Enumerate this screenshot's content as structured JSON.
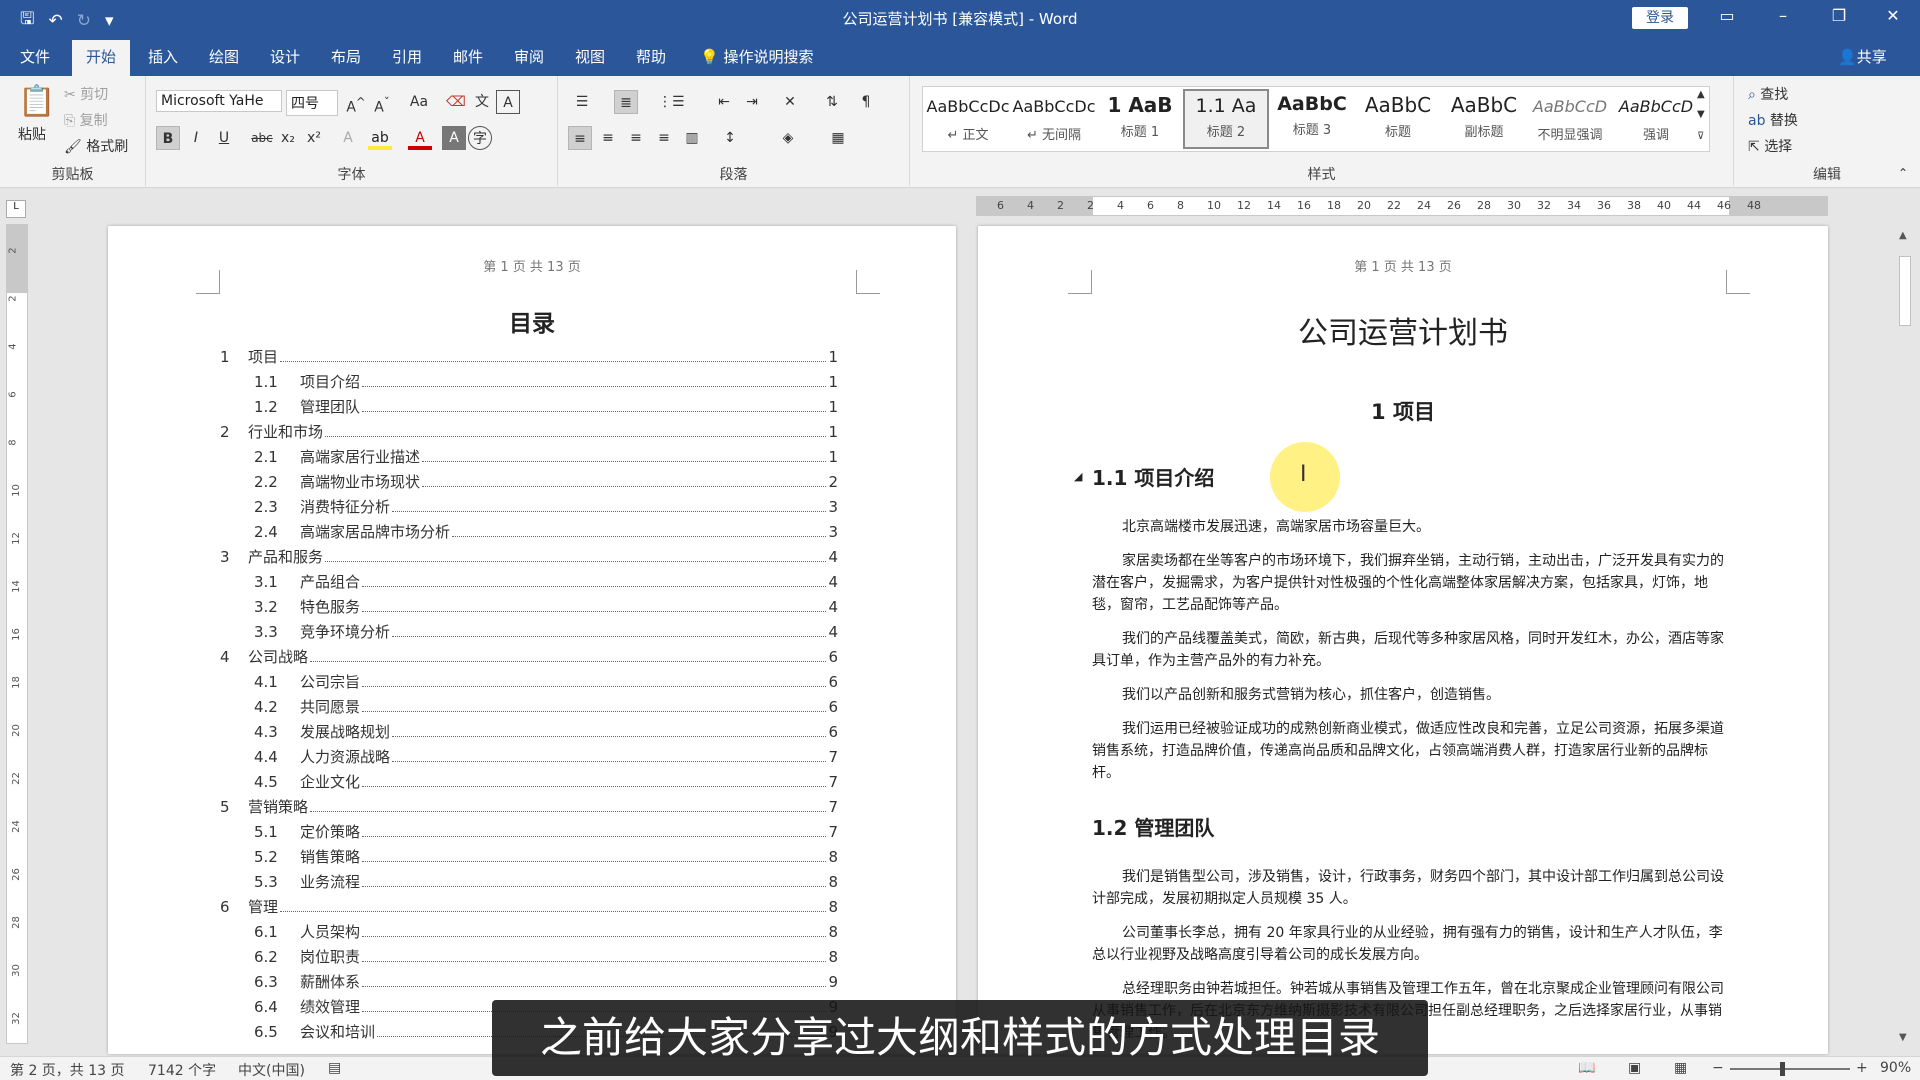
{
  "window": {
    "title": "公司运营计划书 [兼容模式] - Word",
    "login_label": "登录",
    "share_label": "共享",
    "search_label": "操作说明搜索"
  },
  "tabs": [
    "文件",
    "开始",
    "插入",
    "绘图",
    "设计",
    "布局",
    "引用",
    "邮件",
    "审阅",
    "视图",
    "帮助"
  ],
  "ribbon": {
    "clipboard": {
      "label": "剪贴板",
      "paste": "粘贴",
      "cut": "剪切",
      "copy": "复制",
      "format_painter": "格式刷"
    },
    "font": {
      "label": "字体",
      "font_name": "Microsoft YaHe",
      "font_size": "四号",
      "case": "Aa"
    },
    "paragraph": {
      "label": "段落"
    },
    "styles": {
      "label": "样式",
      "items": [
        {
          "sample": "AaBbCcDc",
          "name": "↵ 正文"
        },
        {
          "sample": "AaBbCcDc",
          "name": "↵ 无间隔"
        },
        {
          "sample": "1 AaB",
          "name": "标题 1"
        },
        {
          "sample": "1.1 Aa",
          "name": "标题 2"
        },
        {
          "sample": "AaBbC",
          "name": "标题 3"
        },
        {
          "sample": "AaBbC",
          "name": "标题"
        },
        {
          "sample": "AaBbC",
          "name": "副标题"
        },
        {
          "sample": "AaBbCcD",
          "name": "不明显强调"
        },
        {
          "sample": "AaBbCcD",
          "name": "强调"
        }
      ]
    },
    "editing": {
      "label": "编辑",
      "find": "查找",
      "replace": "替换",
      "select": "选择"
    }
  },
  "ruler": {
    "numbers": [
      "6",
      "4",
      "2",
      "2",
      "4",
      "6",
      "8",
      "10",
      "12",
      "14",
      "16",
      "18",
      "20",
      "22",
      "24",
      "26",
      "28",
      "30",
      "32",
      "34",
      "36",
      "38",
      "40",
      "44",
      "46",
      "48"
    ]
  },
  "vruler": {
    "numbers": [
      "2",
      "2",
      "4",
      "6",
      "8",
      "10",
      "12",
      "14",
      "16",
      "18",
      "20",
      "22",
      "24",
      "26",
      "28",
      "30",
      "32"
    ]
  },
  "toc_page": {
    "header": "第 1 页 共 13 页",
    "title": "目录",
    "entries": [
      {
        "num": "1",
        "text": "项目",
        "page": "1",
        "level": 1
      },
      {
        "num": "1.1",
        "text": "项目介绍",
        "page": "1",
        "level": 2
      },
      {
        "num": "1.2",
        "text": "管理团队",
        "page": "1",
        "level": 2
      },
      {
        "num": "2",
        "text": "行业和市场",
        "page": "1",
        "level": 1
      },
      {
        "num": "2.1",
        "text": "高端家居行业描述",
        "page": "1",
        "level": 2
      },
      {
        "num": "2.2",
        "text": "高端物业市场现状",
        "page": "2",
        "level": 2
      },
      {
        "num": "2.3",
        "text": "消费特征分析",
        "page": "3",
        "level": 2
      },
      {
        "num": "2.4",
        "text": "高端家居品牌市场分析",
        "page": "3",
        "level": 2
      },
      {
        "num": "3",
        "text": "产品和服务",
        "page": "4",
        "level": 1
      },
      {
        "num": "3.1",
        "text": "产品组合",
        "page": "4",
        "level": 2
      },
      {
        "num": "3.2",
        "text": "特色服务",
        "page": "4",
        "level": 2
      },
      {
        "num": "3.3",
        "text": "竞争环境分析",
        "page": "4",
        "level": 2
      },
      {
        "num": "4",
        "text": "公司战略",
        "page": "6",
        "level": 1
      },
      {
        "num": "4.1",
        "text": "公司宗旨",
        "page": "6",
        "level": 2
      },
      {
        "num": "4.2",
        "text": "共同愿景",
        "page": "6",
        "level": 2
      },
      {
        "num": "4.3",
        "text": "发展战略规划",
        "page": "6",
        "level": 2
      },
      {
        "num": "4.4",
        "text": "人力资源战略",
        "page": "7",
        "level": 2
      },
      {
        "num": "4.5",
        "text": "企业文化",
        "page": "7",
        "level": 2
      },
      {
        "num": "5",
        "text": "营销策略",
        "page": "7",
        "level": 1
      },
      {
        "num": "5.1",
        "text": "定价策略",
        "page": "7",
        "level": 2
      },
      {
        "num": "5.2",
        "text": "销售策略",
        "page": "8",
        "level": 2
      },
      {
        "num": "5.3",
        "text": "业务流程",
        "page": "8",
        "level": 2
      },
      {
        "num": "6",
        "text": "管理",
        "page": "8",
        "level": 1
      },
      {
        "num": "6.1",
        "text": "人员架构",
        "page": "8",
        "level": 2
      },
      {
        "num": "6.2",
        "text": "岗位职责",
        "page": "8",
        "level": 2
      },
      {
        "num": "6.3",
        "text": "薪酬体系",
        "page": "9",
        "level": 2
      },
      {
        "num": "6.4",
        "text": "绩效管理",
        "page": "9",
        "level": 2
      },
      {
        "num": "6.5",
        "text": "会议和培训",
        "page": "9",
        "level": 2
      }
    ]
  },
  "doc_page": {
    "header": "第 1 页 共 13 页",
    "title": "公司运营计划书",
    "heading1": "1 项目",
    "heading2a": "1.1 项目介绍",
    "paragraphs_a": [
      "北京高端楼市发展迅速，高端家居市场容量巨大。",
      "家居卖场都在坐等客户的市场环境下，我们摒弃坐销，主动行销，主动出击，广泛开发具有实力的潜在客户，发掘需求，为客户提供针对性极强的个性化高端整体家居解决方案，包括家具，灯饰，地毯，窗帘，工艺品配饰等产品。",
      "我们的产品线覆盖美式，简欧，新古典，后现代等多种家居风格，同时开发红木，办公，酒店等家具订单，作为主营产品外的有力补充。",
      "我们以产品创新和服务式营销为核心，抓住客户，创造销售。",
      "我们运用已经被验证成功的成熟创新商业模式，做适应性改良和完善，立足公司资源，拓展多渠道销售系统，打造品牌价值，传递高尚品质和品牌文化，占领高端消费人群，打造家居行业新的品牌标杆。"
    ],
    "heading2b": "1.2 管理团队",
    "paragraphs_b": [
      "我们是销售型公司，涉及销售，设计，行政事务，财务四个部门，其中设计部工作归属到总公司设计部完成，发展初期拟定人员规模 35 人。",
      "公司董事长李总，拥有 20 年家具行业的从业经验，拥有强有力的销售，设计和生产人才队伍，李总以行业视野及战略高度引导着公司的成长发展方向。",
      "总经理职务由钟若城担任。钟若城从事销售及管理工作五年，曾在北京聚成企业管理顾问有限公司从事销售工作，后在北京东方维纳斯摄影技术有限公司担任副总经理职务，之后选择家居行业，从事销售管理工作。"
    ]
  },
  "status": {
    "page": "第 2 页，共 13 页",
    "words": "7142 个字",
    "language": "中文(中国)",
    "zoom": "90%"
  },
  "subtitle": "之前给大家分享过大纲和样式的方式处理目录"
}
